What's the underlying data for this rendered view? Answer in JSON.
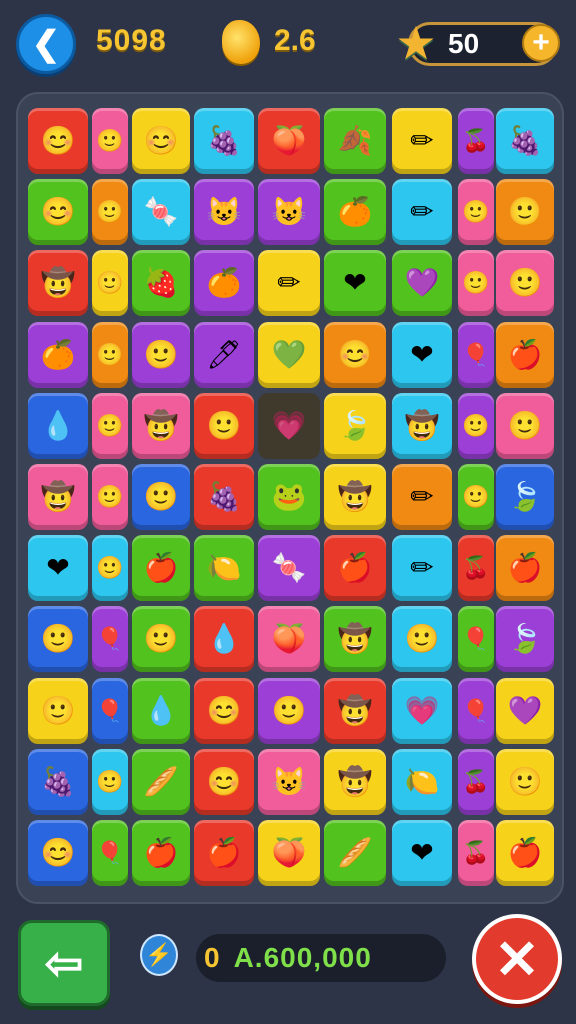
{
  "header": {
    "back_icon": "chevron-left-icon",
    "score": "5098",
    "coin_icon": "coin-icon",
    "multiplier": "2.6",
    "lives_icon": "star-icon",
    "lives": "50",
    "plus_label": "+"
  },
  "board": {
    "rows": [
      [
        [
          "red",
          "😊"
        ],
        [
          "pink",
          "🙂"
        ],
        [
          "yellow",
          "😊"
        ],
        [
          "cyan",
          "🍇"
        ],
        [
          "red",
          "🍑"
        ],
        [
          "green",
          "🍂"
        ],
        [
          "yellow",
          "✏"
        ],
        [
          "purple",
          "🍒"
        ],
        [
          "cyan",
          "🍇"
        ]
      ],
      [
        [
          "green",
          "😊"
        ],
        [
          "orange",
          "🙂"
        ],
        [
          "cyan",
          "🍬"
        ],
        [
          "purple",
          "😺"
        ],
        [
          "purple",
          "😺"
        ],
        [
          "green",
          "🍊"
        ],
        [
          "cyan",
          "✏"
        ],
        [
          "pink",
          "🙂"
        ],
        [
          "orange",
          "🙂"
        ]
      ],
      [
        [
          "red",
          "🤠"
        ],
        [
          "yellow",
          "🙂"
        ],
        [
          "green",
          "🍓"
        ],
        [
          "purple",
          "🍊"
        ],
        [
          "yellow",
          "✏"
        ],
        [
          "green",
          "❤"
        ],
        [
          "green",
          "💜"
        ],
        [
          "pink",
          "🙂"
        ],
        [
          "pink",
          "🙂"
        ]
      ],
      [
        [
          "purple",
          "🍊"
        ],
        [
          "orange",
          "🙂"
        ],
        [
          "purple",
          "🙂"
        ],
        [
          "purple",
          "🖊"
        ],
        [
          "yellow",
          "💚"
        ],
        [
          "orange",
          "😊"
        ],
        [
          "cyan",
          "❤"
        ],
        [
          "purple",
          "🎈"
        ],
        [
          "orange",
          "🍎"
        ]
      ],
      [
        [
          "blue",
          "💧"
        ],
        [
          "pink",
          "🙂"
        ],
        [
          "pink",
          "🤠"
        ],
        [
          "red",
          "🙂"
        ],
        [
          "empty",
          "💗"
        ],
        [
          "yellow",
          "🍃"
        ],
        [
          "cyan",
          "🤠"
        ],
        [
          "purple",
          "🙂"
        ],
        [
          "pink",
          "🙂"
        ]
      ],
      [
        [
          "pink",
          "🤠"
        ],
        [
          "pink",
          "🙂"
        ],
        [
          "blue",
          "🙂"
        ],
        [
          "red",
          "🍇"
        ],
        [
          "green",
          "🐸"
        ],
        [
          "yellow",
          "🤠"
        ],
        [
          "orange",
          "✏"
        ],
        [
          "green",
          "🙂"
        ],
        [
          "blue",
          "🍃"
        ]
      ],
      [
        [
          "cyan",
          "❤"
        ],
        [
          "cyan",
          "🙂"
        ],
        [
          "green",
          "🍎"
        ],
        [
          "green",
          "🍋"
        ],
        [
          "purple",
          "🍬"
        ],
        [
          "red",
          "🍎"
        ],
        [
          "cyan",
          "✏"
        ],
        [
          "red",
          "🍒"
        ],
        [
          "orange",
          "🍎"
        ]
      ],
      [
        [
          "blue",
          "🙂"
        ],
        [
          "purple",
          "🎈"
        ],
        [
          "green",
          "🙂"
        ],
        [
          "red",
          "💧"
        ],
        [
          "pink",
          "🍑"
        ],
        [
          "green",
          "🤠"
        ],
        [
          "cyan",
          "🙂"
        ],
        [
          "green",
          "🎈"
        ],
        [
          "purple",
          "🍃"
        ]
      ],
      [
        [
          "yellow",
          "🙂"
        ],
        [
          "blue",
          "🎈"
        ],
        [
          "green",
          "💧"
        ],
        [
          "red",
          "😊"
        ],
        [
          "purple",
          "🙂"
        ],
        [
          "red",
          "🤠"
        ],
        [
          "cyan",
          "💗"
        ],
        [
          "purple",
          "🎈"
        ],
        [
          "yellow",
          "💜"
        ]
      ],
      [
        [
          "blue",
          "🍇"
        ],
        [
          "cyan",
          "🙂"
        ],
        [
          "green",
          "🥖"
        ],
        [
          "red",
          "😊"
        ],
        [
          "pink",
          "😺"
        ],
        [
          "yellow",
          "🤠"
        ],
        [
          "cyan",
          "🍋"
        ],
        [
          "purple",
          "🍒"
        ],
        [
          "yellow",
          "🙂"
        ]
      ],
      [
        [
          "blue",
          "😊"
        ],
        [
          "green",
          "🎈"
        ],
        [
          "green",
          "🍎"
        ],
        [
          "red",
          "🍎"
        ],
        [
          "yellow",
          "🍑"
        ],
        [
          "green",
          "🥖"
        ],
        [
          "cyan",
          "❤"
        ],
        [
          "pink",
          "🍒"
        ],
        [
          "yellow",
          "🍎"
        ]
      ]
    ],
    "colors": {
      "red": "#e8392b",
      "pink": "#f05d9a",
      "yellow": "#f7d21a",
      "cyan": "#2cc6ee",
      "green": "#52c21e",
      "orange": "#f08a12",
      "purple": "#9b3fd6",
      "blue": "#2a66e0",
      "empty": "#3f3a2c"
    }
  },
  "footer": {
    "back_icon": "return-arrow-icon",
    "bolt_icon": "lightning-icon",
    "counter_prefix": "0",
    "counter_value": "A.600,000",
    "close_icon": "close-icon",
    "close_label": "✕"
  }
}
